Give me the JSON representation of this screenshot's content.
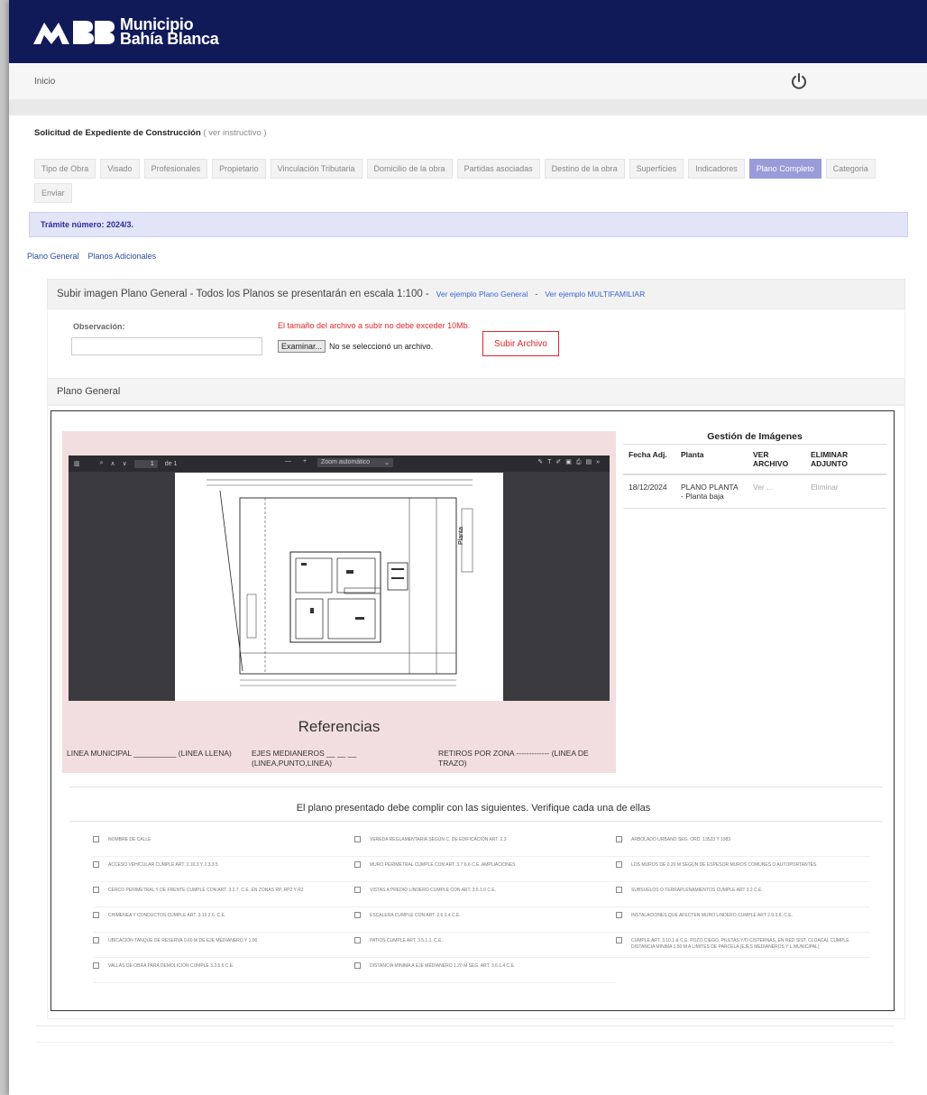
{
  "brand": {
    "line1": "Municipio",
    "line2": "Bahía Blanca"
  },
  "nav": {
    "inicio": "Inicio"
  },
  "page": {
    "title": "Solicitud de Expediente de Construcción",
    "instructivo": "( ver instructivo )"
  },
  "tabs": [
    {
      "label": "Tipo de Obra",
      "active": false
    },
    {
      "label": "Visado",
      "active": false
    },
    {
      "label": "Profesionales",
      "active": false
    },
    {
      "label": "Propietario",
      "active": false
    },
    {
      "label": "Vinculación Tributaria",
      "active": false
    },
    {
      "label": "Domicilio de la obra",
      "active": false
    },
    {
      "label": "Partidas asociadas",
      "active": false
    },
    {
      "label": "Destino de la obra",
      "active": false
    },
    {
      "label": "Superficies",
      "active": false
    },
    {
      "label": "Indicadores",
      "active": false
    },
    {
      "label": "Plano Completo",
      "active": true
    },
    {
      "label": "Categoria",
      "active": false
    },
    {
      "label": "Enviar",
      "active": false
    }
  ],
  "tramite": "Trámite número: 2024/3.",
  "subnav": {
    "general": "Plano General",
    "adicionales": "Planos Adicionales"
  },
  "upload": {
    "heading": "Subir imagen Plano General - Todos los Planos se presentarán en escala 1:100 -",
    "link1": "Ver ejemplo Plano General",
    "dash": "-",
    "link2": "Ver ejemplo MULTIFAMILIAR",
    "obs_label": "Observación:",
    "obs_value": "",
    "warning": "El tamaño del archivo a subir no debe exceder 10Mb.",
    "browse": "Examinar...",
    "no_file": "No se seleccionó un archivo.",
    "submit": "Subir Archivo"
  },
  "section_title": "Plano General",
  "viewer": {
    "page": "1",
    "of": "de 1",
    "zoom": "Zoom automático",
    "zoom_minus": "—",
    "zoom_plus": "+",
    "drawing_label": "Planta"
  },
  "referencias": {
    "title": "Referencias",
    "r1": "LINEA MUNICIPAL __________ (LINEA LLENA)",
    "r2": "EJES MEDIANEROS __ __ __ (LINEA,PUNTO,LINEA)",
    "r3": "RETIROS POR ZONA ------------- (LINEA DE TRAZO)"
  },
  "gestion": {
    "title": "Gestión de Imágenes",
    "headers": [
      "Fecha Adj.",
      "Planta",
      "VER ARCHIVO",
      "ELIMINAR ADJUNTO"
    ],
    "rows": [
      {
        "fecha": "18/12/2024",
        "planta": "PLANO PLANTA - Planta baja",
        "ver": "Ver ...",
        "eliminar": "Eliminar"
      }
    ]
  },
  "verificacion": {
    "title": "El plano presentado debe complir con las siguientes. Verifique cada una de ellas",
    "items": [
      "NOMBRE DE CALLE",
      "VEREDA REGLAMENTARIA SEGÚN C. DE EDIFICACIÓN ART. 2.3",
      "ARBOLADO URBANO SEG. ORD. 13523 Y 1983",
      "ACCESO VEHICULAR CUMPLE ART. 2.10.3 Y 2.3.3.5",
      "MURO PERIMETRAL CUMPLE CON ART. 3.7.6.6 C.E. AMPLIACIONES",
      "LOS MUROS DE 0.20 M SEGÚN DE ESPESOR MUROS COMUNES O AUTOPORTANTES",
      "CERCO PERIMETRAL Y DE FRENTE CUMPLE CON ART. 3.2.7. C.E. EN ZONAS RP, RP2 Y R2",
      "VISTAS A PREDIO LINDERO CUMPLE CON ART. 3.5.1.0 C.E.",
      "SUBSUELOS O TERRAPLENAMIENTOS CUMPLE ART 3.2 C.E.",
      "CHIMENEA Y CONDUCTOS CUMPLE ART. 3.12.2.6. C.E.",
      "ESCALERA CUMPLE CON ART. 2.6.3.4 C.E.",
      "INSTALACIONES QUE AFECTEN MURO LINDERO CUMPLE ART 2.9.3.6. C.E.",
      "UBICACIÓN TANQUE DE RESERVA 0.60 M DE EJE MEDIANERO Y 1.00",
      "PATIOS CUMPLE ART. 3.5.1.1. C.E.",
      "CUMPLE ART. 3.10.1 & C.E. POZO CIEGO, PILETAS Y/O CISTERNAS, EN RED SIST. CLOACAL CUMPLE DISTANCIA MINIMA 1.50 M A LIMITES DE PARCELA (EJES MEDIANEROS Y L.MUNICIPAL)",
      "VALLAS DE OBRA PARA DEMOLICIÓN CUMPLE 3.2.5.6 C.E.",
      "DISTANCIA MINIMA A EJE MEDIANERO 1.20 M SEG. ART. 3.6.1.4 C.E.",
      ""
    ]
  },
  "colors": {
    "header": "#111a59",
    "active_tab": "#9a9bd9",
    "warning": "#e0262a",
    "link": "#3a63d6",
    "pink": "#f2dede"
  }
}
